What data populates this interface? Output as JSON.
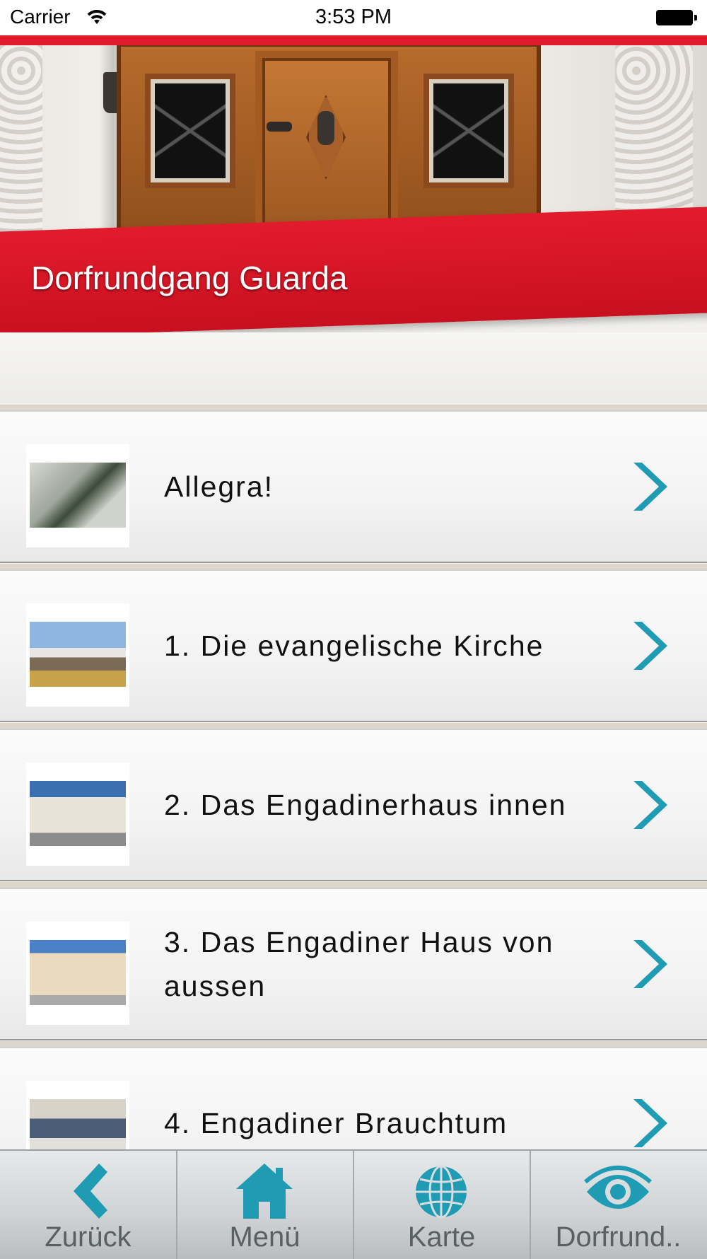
{
  "status_bar": {
    "carrier": "Carrier",
    "time": "3:53 PM"
  },
  "header": {
    "title": "Dorfrundgang Guarda"
  },
  "list": {
    "items": [
      {
        "label": "Allegra!"
      },
      {
        "label": "1. Die evangelische Kirche"
      },
      {
        "label": "2. Das Engadinerhaus innen"
      },
      {
        "label": "3. Das Engadiner Haus von aussen"
      },
      {
        "label": "4. Engadiner Brauchtum"
      }
    ]
  },
  "tab_bar": {
    "tabs": [
      {
        "label": "Zurück",
        "icon": "back-chevron-icon"
      },
      {
        "label": "Menü",
        "icon": "home-icon"
      },
      {
        "label": "Karte",
        "icon": "globe-icon"
      },
      {
        "label": "Dorfrund..",
        "icon": "eye-icon"
      }
    ]
  },
  "colors": {
    "brand_red": "#e21b2c",
    "accent_teal": "#1f9bb4",
    "tab_label": "#5a5f62"
  }
}
